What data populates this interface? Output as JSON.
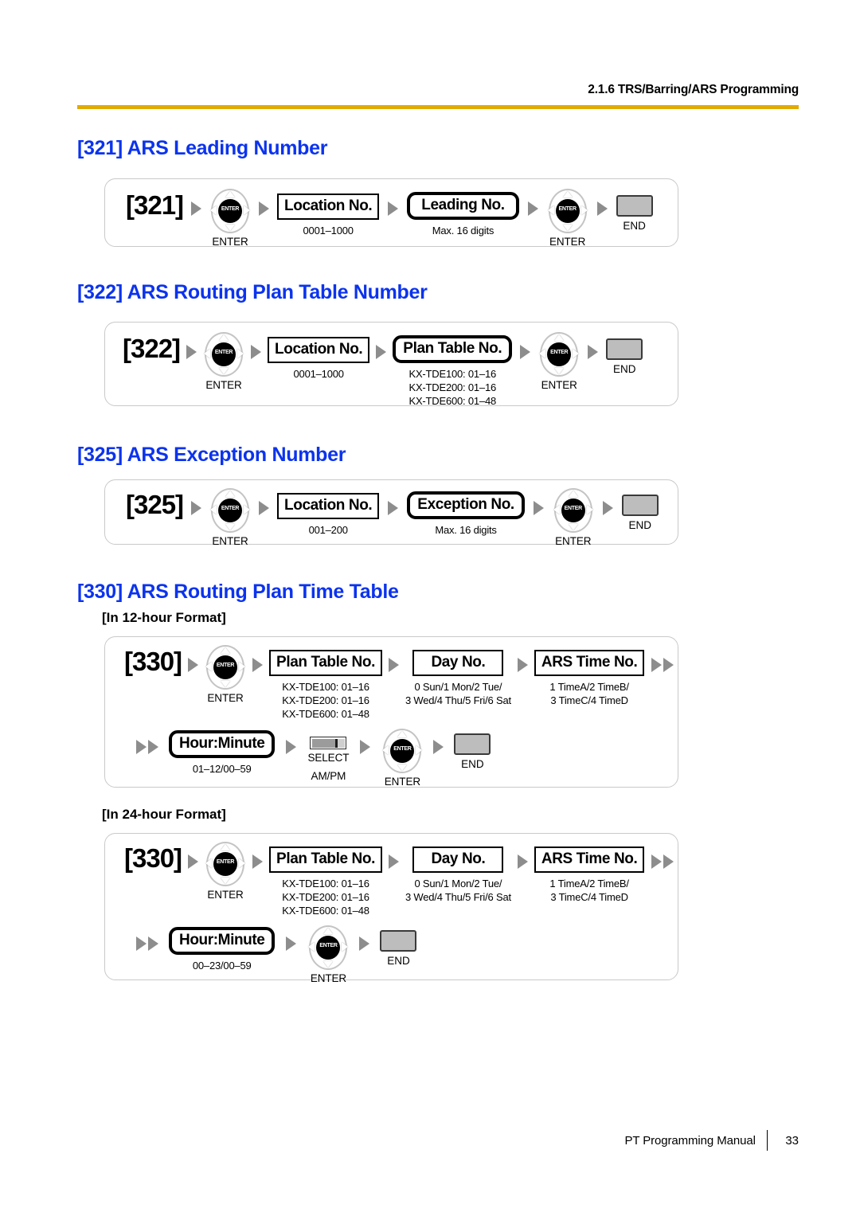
{
  "header": {
    "section_ref": "2.1.6 TRS/Barring/ARS Programming"
  },
  "footer": {
    "manual_title": "PT Programming Manual",
    "page_number": "33"
  },
  "colors": {
    "heading_blue": "#0b33ee",
    "rule_gold": "#e0ab00",
    "key_gray": "#bdbdbd",
    "arrow_gray": "#8d8d8d"
  },
  "common": {
    "enter_caption": "ENTER",
    "end_caption": "END",
    "select_caption": "SELECT",
    "select_sub_caption": "AM/PM",
    "enter_key_label": "ENTER"
  },
  "sections": [
    {
      "id": "321",
      "heading": "[321] ARS Leading Number",
      "rows": [
        {
          "steps": [
            {
              "kind": "code",
              "label": "[321]"
            },
            {
              "kind": "navkey",
              "caption": "ENTER"
            },
            {
              "kind": "box-thin",
              "label": "Location No.",
              "caption": "0001–1000"
            },
            {
              "kind": "box-thick",
              "label": "Leading No.",
              "caption": "Max. 16 digits"
            },
            {
              "kind": "navkey",
              "caption": "ENTER"
            },
            {
              "kind": "endkey",
              "caption": "END"
            }
          ]
        }
      ]
    },
    {
      "id": "322",
      "heading": "[322] ARS Routing Plan Table Number",
      "rows": [
        {
          "steps": [
            {
              "kind": "code",
              "label": "[322]"
            },
            {
              "kind": "navkey",
              "caption": "ENTER"
            },
            {
              "kind": "box-thin",
              "label": "Location No.",
              "caption": "0001–1000"
            },
            {
              "kind": "box-thick",
              "label": "Plan Table No.",
              "caption": "KX-TDE100: 01–16\nKX-TDE200: 01–16\nKX-TDE600: 01–48"
            },
            {
              "kind": "navkey",
              "caption": "ENTER"
            },
            {
              "kind": "endkey",
              "caption": "END"
            }
          ]
        }
      ]
    },
    {
      "id": "325",
      "heading": "[325] ARS Exception Number",
      "rows": [
        {
          "steps": [
            {
              "kind": "code",
              "label": "[325]"
            },
            {
              "kind": "navkey",
              "caption": "ENTER"
            },
            {
              "kind": "box-thin",
              "label": "Location No.",
              "caption": "001–200"
            },
            {
              "kind": "box-thick",
              "label": "Exception No.",
              "caption": "Max. 16 digits"
            },
            {
              "kind": "navkey",
              "caption": "ENTER"
            },
            {
              "kind": "endkey",
              "caption": "END"
            }
          ]
        }
      ]
    },
    {
      "id": "330",
      "heading": "[330] ARS Routing Plan Time Table",
      "format_12_label": "[In 12-hour Format]",
      "format_24_label": "[In 24-hour Format]",
      "rows_12": [
        {
          "steps": [
            {
              "kind": "code",
              "label": "[330]"
            },
            {
              "kind": "navkey",
              "caption": "ENTER"
            },
            {
              "kind": "box-thin",
              "label": "Plan Table No.",
              "caption": "KX-TDE100: 01–16\nKX-TDE200: 01–16\nKX-TDE600: 01–48"
            },
            {
              "kind": "box-thin",
              "label": "Day No.",
              "caption": "0 Sun/1 Mon/2 Tue/\n3 Wed/4 Thu/5 Fri/6 Sat"
            },
            {
              "kind": "box-thin",
              "label": "ARS Time No.",
              "caption": "1 TimeA/2 TimeB/\n3 TimeC/4 TimeD"
            },
            {
              "kind": "arrow-double"
            }
          ]
        },
        {
          "steps": [
            {
              "kind": "arrow-double"
            },
            {
              "kind": "box-thick",
              "label": "Hour:Minute",
              "caption": "01–12/00–59"
            },
            {
              "kind": "selectkey",
              "caption": "SELECT",
              "sub_caption": "AM/PM"
            },
            {
              "kind": "navkey",
              "caption": "ENTER"
            },
            {
              "kind": "endkey",
              "caption": "END"
            }
          ]
        }
      ],
      "rows_24": [
        {
          "steps": [
            {
              "kind": "code",
              "label": "[330]"
            },
            {
              "kind": "navkey",
              "caption": "ENTER"
            },
            {
              "kind": "box-thin",
              "label": "Plan Table No.",
              "caption": "KX-TDE100: 01–16\nKX-TDE200: 01–16\nKX-TDE600: 01–48"
            },
            {
              "kind": "box-thin",
              "label": "Day No.",
              "caption": "0 Sun/1 Mon/2 Tue/\n3 Wed/4 Thu/5 Fri/6 Sat"
            },
            {
              "kind": "box-thin",
              "label": "ARS Time No.",
              "caption": "1 TimeA/2 TimeB/\n3 TimeC/4 TimeD"
            },
            {
              "kind": "arrow-double"
            }
          ]
        },
        {
          "steps": [
            {
              "kind": "arrow-double"
            },
            {
              "kind": "box-thick",
              "label": "Hour:Minute",
              "caption": "00–23/00–59"
            },
            {
              "kind": "navkey",
              "caption": "ENTER"
            },
            {
              "kind": "endkey",
              "caption": "END"
            }
          ]
        }
      ]
    }
  ]
}
